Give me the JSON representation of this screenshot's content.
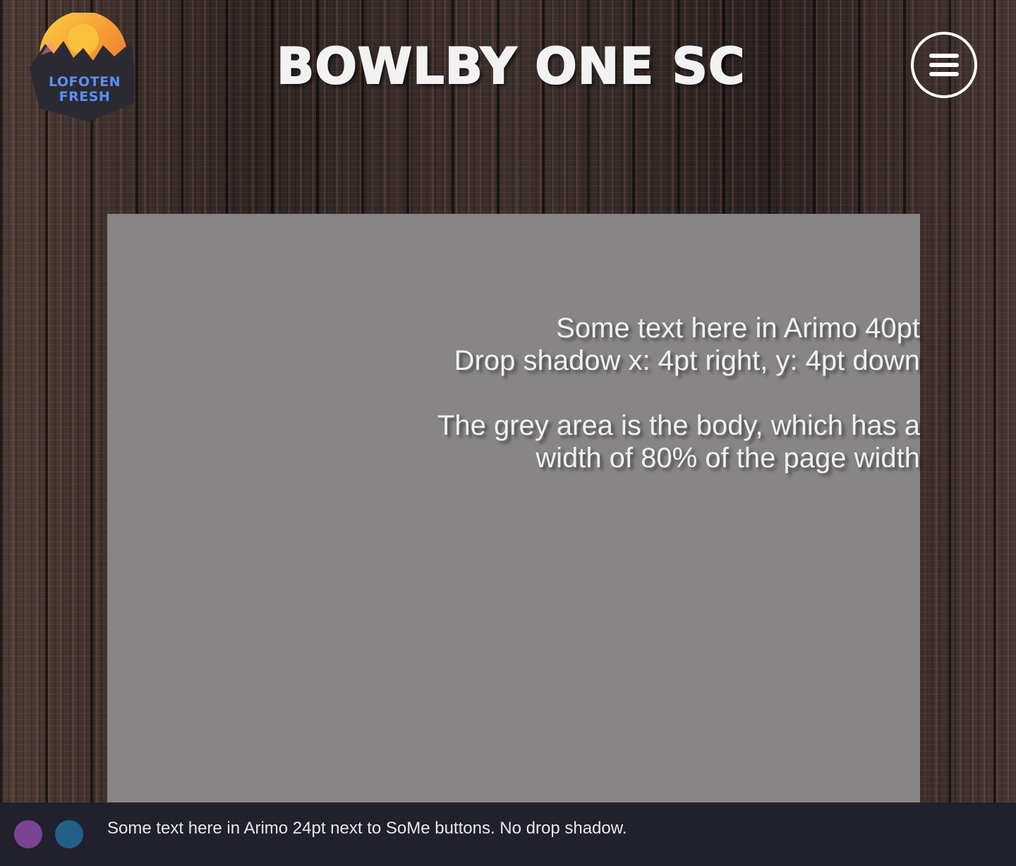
{
  "logo": {
    "line1": "LOFOTEN",
    "line2": "FRESH",
    "icon": "logo-icon"
  },
  "header": {
    "title": "BOWLBY ONE SC",
    "menu_icon": "hamburger-menu-icon"
  },
  "main": {
    "lines": [
      "Some text here in Arimo 40pt",
      "Drop shadow x: 4pt right, y: 4pt down",
      "The grey area is the body, which has a",
      "width of 80% of the page width"
    ]
  },
  "footer": {
    "text": "Some text here in Arimo 24pt next to SoMe buttons. No drop shadow.",
    "social_buttons": [
      {
        "icon": "social-button-1",
        "color": "#7b4393"
      },
      {
        "icon": "social-button-2",
        "color": "#236089"
      }
    ]
  },
  "colors": {
    "body_grey": "#878586",
    "footer_bg": "#21202d",
    "logo_text": "#5b8ff0",
    "logo_sun": "#f7a23b"
  }
}
